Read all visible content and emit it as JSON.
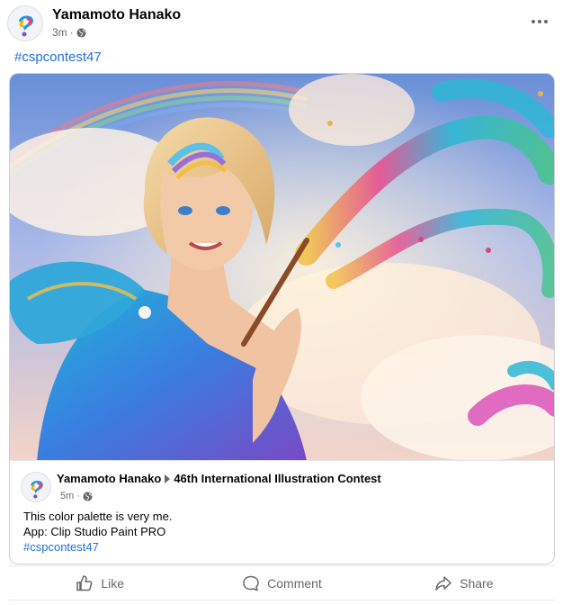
{
  "post": {
    "author": "Yamamoto Hanako",
    "time": "3m",
    "hashtag": "#cspcontest47"
  },
  "shared": {
    "author": "Yamamoto Hanako",
    "group": "46th International Illustration Contest",
    "time": "5m",
    "lines": [
      "This color palette is very me.",
      "App: Clip Studio Paint PRO",
      "#cspcontest47"
    ]
  },
  "actions": {
    "like": "Like",
    "comment": "Comment",
    "share": "Share"
  },
  "icons": [
    "clip-studio-logo-icon",
    "globe-icon",
    "more-options-icon",
    "like-icon",
    "comment-icon",
    "share-icon"
  ],
  "colors": {
    "link": "#216fdb",
    "meta": "#65676b",
    "text": "#050505"
  }
}
